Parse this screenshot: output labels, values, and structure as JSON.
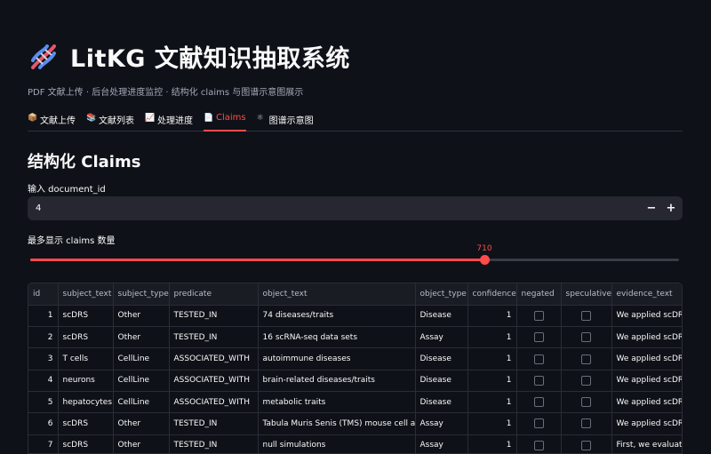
{
  "app": {
    "title": "LitKG 文献知识抽取系统",
    "subtitle": "PDF 文献上传 · 后台处理进度监控 · 结构化 claims 与图谱示意图展示"
  },
  "tabs": [
    {
      "label": "文献上传",
      "icon": "package-icon",
      "active": false
    },
    {
      "label": "文献列表",
      "icon": "books-icon",
      "active": false
    },
    {
      "label": "处理进度",
      "icon": "chart-icon",
      "active": false
    },
    {
      "label": "Claims",
      "icon": "page-icon",
      "active": true
    },
    {
      "label": "图谱示意图",
      "icon": "atom-icon",
      "active": false
    }
  ],
  "section": {
    "title": "结构化 Claims"
  },
  "document_input": {
    "label": "输入 document_id",
    "value": "4",
    "minus": "−",
    "plus": "+"
  },
  "slider": {
    "label": "最多显示 claims 数量",
    "value": "710",
    "fraction": 0.7
  },
  "colors": {
    "accent": "#ff4b4b",
    "background": "#0e1117",
    "input_bg": "#262730"
  },
  "table": {
    "columns": [
      "id",
      "subject_text",
      "subject_type",
      "predicate",
      "object_text",
      "object_type",
      "confidence",
      "negated",
      "speculative",
      "evidence_text"
    ],
    "rows": [
      [
        "1",
        "scDRS",
        "Other",
        "TESTED_IN",
        "74 diseases/traits",
        "Disease",
        "1",
        false,
        false,
        "We applied scDRS to"
      ],
      [
        "2",
        "scDRS",
        "Other",
        "TESTED_IN",
        "16 scRNA-seq data sets",
        "Assay",
        "1",
        false,
        false,
        "We applied scDRS to"
      ],
      [
        "3",
        "T cells",
        "CellLine",
        "ASSOCIATED_WITH",
        "autoimmune diseases",
        "Disease",
        "1",
        false,
        false,
        "We applied scDRS to"
      ],
      [
        "4",
        "neurons",
        "CellLine",
        "ASSOCIATED_WITH",
        "brain-related diseases/traits",
        "Disease",
        "1",
        false,
        false,
        "We applied scDRS to"
      ],
      [
        "5",
        "hepatocytes",
        "CellLine",
        "ASSOCIATED_WITH",
        "metabolic traits",
        "Disease",
        "1",
        false,
        false,
        "We applied scDRS to"
      ],
      [
        "6",
        "scDRS",
        "Other",
        "TESTED_IN",
        "Tabula Muris Senis (TMS) mouse cell atlas",
        "Assay",
        "1",
        false,
        false,
        "We applied scDRS to"
      ],
      [
        "7",
        "scDRS",
        "Other",
        "TESTED_IN",
        "null simulations",
        "Assay",
        "1",
        false,
        false,
        "First, we evaluated"
      ]
    ]
  }
}
